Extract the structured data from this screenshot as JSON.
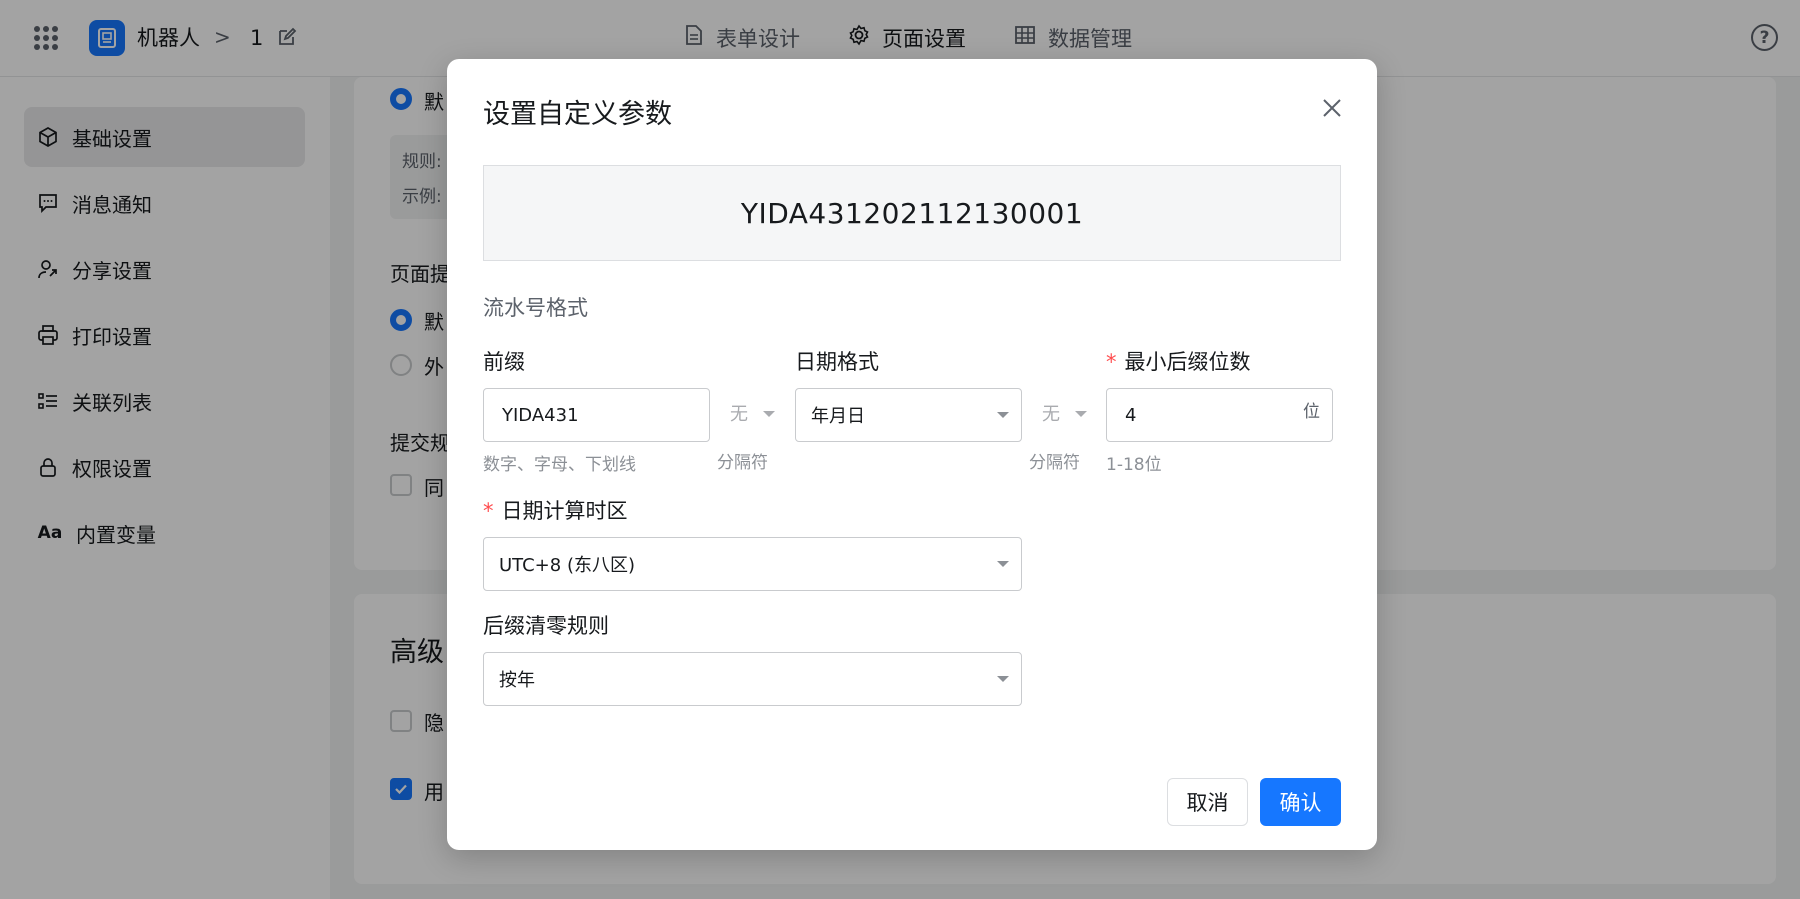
{
  "topbar": {
    "app_name": "机器人",
    "crumb_chevron": ">",
    "crumb_page": "1",
    "tabs": [
      {
        "label": "表单设计",
        "icon": "document-icon"
      },
      {
        "label": "页面设置",
        "icon": "gear-icon"
      },
      {
        "label": "数据管理",
        "icon": "table-icon"
      }
    ],
    "help": "?"
  },
  "sidebar": {
    "items": [
      {
        "label": "基础设置",
        "icon": "cube-icon",
        "active": true
      },
      {
        "label": "消息通知",
        "icon": "message-icon"
      },
      {
        "label": "分享设置",
        "icon": "share-user-icon"
      },
      {
        "label": "打印设置",
        "icon": "printer-icon"
      },
      {
        "label": "关联列表",
        "icon": "list-icon"
      },
      {
        "label": "权限设置",
        "icon": "lock-icon"
      },
      {
        "label": "内置变量",
        "icon": "font-icon"
      }
    ]
  },
  "background": {
    "option_default_1": "默",
    "rule_line": "规则:",
    "example_line": "示例:",
    "page_section": "页面提",
    "option_default_2": "默",
    "option_external": "外",
    "submit_section": "提交规",
    "submit_option": "同",
    "advanced_title": "高级",
    "hide_option": "隐",
    "use_option": "用"
  },
  "modal": {
    "title": "设置自定义参数",
    "preview": "YIDA431202112130001",
    "section_label": "流水号格式",
    "prefix": {
      "label": "前缀",
      "value": "YIDA431",
      "hint": "数字、字母、下划线"
    },
    "separator_1": {
      "value": "无",
      "hint": "分隔符"
    },
    "date_format": {
      "label": "日期格式",
      "value": "年月日"
    },
    "separator_2": {
      "value": "无",
      "hint": "分隔符"
    },
    "min_suffix": {
      "required_mark": "*",
      "label": "最小后缀位数",
      "value": "4",
      "unit": "位",
      "hint": "1-18位"
    },
    "timezone": {
      "required_mark": "*",
      "label": "日期计算时区",
      "value": "UTC+8 (东八区)"
    },
    "reset_rule": {
      "label": "后缀清零规则",
      "value": "按年"
    },
    "cancel_label": "取消",
    "confirm_label": "确认"
  },
  "colors": {
    "accent": "#1677ff",
    "required": "#ff4d4f",
    "overlay": "rgba(0,0,0,0.36)"
  }
}
